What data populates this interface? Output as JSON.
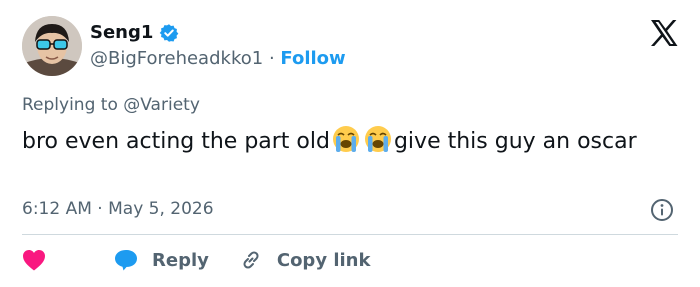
{
  "author": {
    "display_name": "Seng1",
    "handle": "@BigForeheadkko1",
    "separator": "·",
    "follow_label": "Follow"
  },
  "reply_context": {
    "prefix": "Replying to ",
    "mention": "@Variety"
  },
  "tweet": {
    "text_part1": "bro even acting the part old",
    "text_part2": "give this guy an oscar",
    "emojis": [
      "loudly-crying-face",
      "loudly-crying-face"
    ]
  },
  "timestamp": {
    "time": "6:12 AM",
    "separator": "·",
    "date": "May 5, 2026"
  },
  "actions": {
    "reply_label": "Reply",
    "copy_label": "Copy link"
  },
  "colors": {
    "accent": "#1d9bf0",
    "like": "#f91880",
    "text": "#0f1419",
    "muted": "#536471",
    "divider": "#cfd9de"
  }
}
